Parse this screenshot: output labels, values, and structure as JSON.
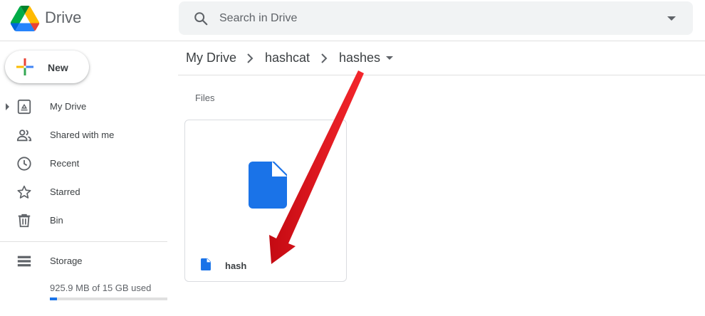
{
  "header": {
    "app_name": "Drive",
    "search": {
      "placeholder": "Search in Drive"
    }
  },
  "sidebar": {
    "new_label": "New",
    "items": [
      {
        "label": "My Drive",
        "icon": "my-drive-icon"
      },
      {
        "label": "Shared with me",
        "icon": "shared-icon"
      },
      {
        "label": "Recent",
        "icon": "clock-icon"
      },
      {
        "label": "Starred",
        "icon": "star-icon"
      },
      {
        "label": "Bin",
        "icon": "trash-icon"
      }
    ],
    "storage": {
      "label": "Storage",
      "used_text": "925.9 MB of 15 GB used",
      "used_fraction": 0.06
    }
  },
  "breadcrumb": [
    "My Drive",
    "hashcat",
    "hashes"
  ],
  "main": {
    "section_label": "Files",
    "files": [
      {
        "name": "hash",
        "icon": "doc-icon"
      }
    ]
  },
  "colors": {
    "accent": "#1a73e8",
    "doc_blue": "#1a73e8",
    "annotation_arrow": "#e3131b"
  }
}
